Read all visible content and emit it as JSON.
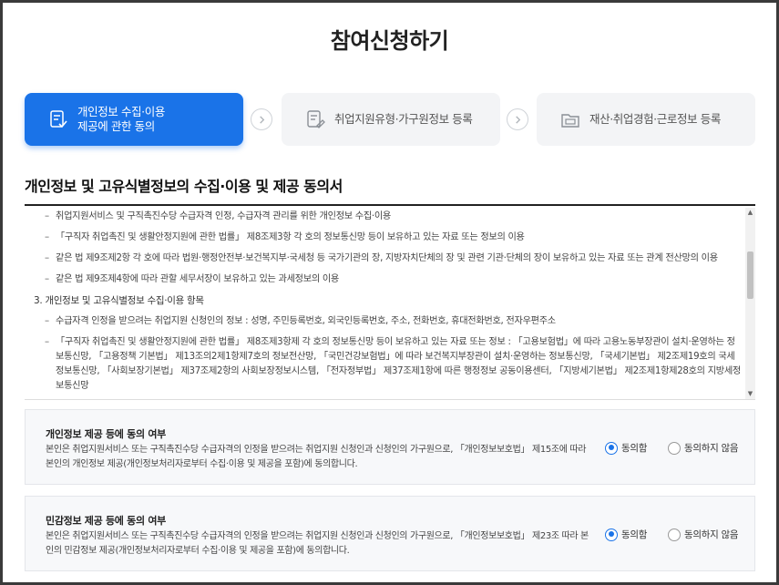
{
  "page": {
    "title": "참여신청하기"
  },
  "steps": [
    {
      "label": "개인정보 수집·이용\n제공에 관한 동의",
      "icon": "document-check-icon",
      "state": "active"
    },
    {
      "label": "취업지원유형·가구원정보 등록",
      "icon": "document-edit-icon",
      "state": "inactive"
    },
    {
      "label": "재산·취업경험·근로정보 등록",
      "icon": "folder-icon",
      "state": "inactive"
    }
  ],
  "colors": {
    "accent": "#1a73e8",
    "step_bg": "#f3f4f6",
    "consent_bg": "#f7f8fa"
  },
  "section": {
    "title": "개인정보 및 고유식별정보의 수집·이용 및 제공 동의서"
  },
  "terms": {
    "items": [
      "취업지원서비스 및 구직촉진수당 수급자격 인정, 수급자격 관리를 위한 개인정보 수집·이용",
      "「구직자 취업촉진 및 생활안정지원에 관한 법률」 제8조제3항 각 호의 정보통신망 등이 보유하고 있는 자료 또는 정보의 이용",
      "같은 법 제9조제2항 각 호에 따라 법원·행정안전부·보건복지부·국세청 등 국가기관의 장, 지방자치단체의 장 및 관련 기관·단체의 장이 보유하고 있는 자료 또는 관계 전산망의 이용",
      "같은 법 제9조제4항에 따라 관할 세무서장이 보유하고 있는 과세정보의 이용"
    ],
    "heading3": "3. 개인정보 및 고유식별정보 수집·이용 항목",
    "items3": [
      "수급자격 인정을 받으려는 취업지원 신청인의 정보 : 성명, 주민등록번호, 외국인등록번호, 주소, 전화번호, 휴대전화번호, 전자우편주소",
      "「구직자 취업촉진 및 생활안정지원에 관한 법률」 제8조제3항제 각 호의 정보통신망 등이 보유하고 있는 자료 또는 정보 : 「고용보험법」에 따라 고용노동부장관이 설치·운영하는 정보통신망, 「고용정책 기본법」 제13조의2제1항제7호의 정보전산망, 「국민건강보험법」에 따라 보건복지부장관이 설치·운영하는 정보통신망, 「국세기본법」 제2조제19호의 국세정보통신망, 「사회보장기본법」 제37조제2항의 사회보장정보시스템, 「전자정부법」 제37조제1항에 따른 행정정보 공동이용센터, 「지방세기본법」 제2조제1항제28호의 지방세정보통신망"
    ]
  },
  "consents": [
    {
      "title": "개인정보 제공 등에 동의 여부",
      "desc": "본인은 취업지원서비스 또는 구직촉진수당 수급자격의 인정을 받으려는 취업지원 신청인과 신청인의 가구원으로, 「개인정보보호법」 제15조에 따라 본인의 개인정보 제공(개인정보처리자로부터 수집·이용 및 제공을 포함)에 동의합니다.",
      "agree": "동의함",
      "disagree": "동의하지 않음",
      "selected": "agree"
    },
    {
      "title": "민감정보 제공 등에 동의 여부",
      "desc": "본인은 취업지원서비스 또는 구직촉진수당 수급자격의 인정을 받으려는 취업지원 신청인과 신청인의 가구원으로, 「개인정보보호법」 제23조 따라 본인의 민감정보 제공(개인정보처리자로부터 수집·이용 및 제공을 포함)에 동의합니다.",
      "agree": "동의함",
      "disagree": "동의하지 않음",
      "selected": "agree"
    }
  ]
}
